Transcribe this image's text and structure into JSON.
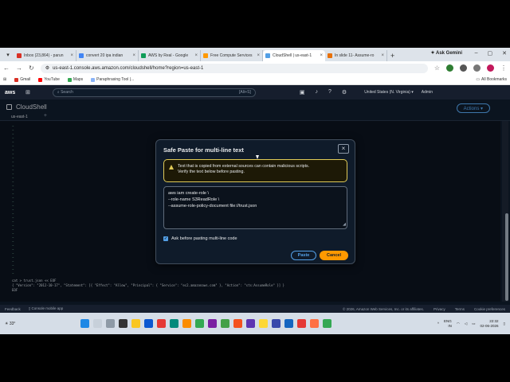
{
  "browser": {
    "tabs": [
      {
        "label": "Inbox (23,864) - parun",
        "color": "#d93025"
      },
      {
        "label": "convert 20 ipa indian",
        "color": "#4285f4"
      },
      {
        "label": "AWS by Real - Google",
        "color": "#0f9d58"
      },
      {
        "label": "Free Compute Services",
        "color": "#ff9900"
      },
      {
        "label": "CloudShell | us-east-1",
        "color": "#539fe5"
      },
      {
        "label": "In slide 11- Assume-ro",
        "color": "#e8710a"
      }
    ],
    "gemini_label": "Ask Gemini",
    "url": "us-east-1.console.aws.amazon.com/cloudshell/home?region=us-east-1",
    "bookmarks": [
      {
        "label": "Gmail",
        "color": "#d93025"
      },
      {
        "label": "YouTube",
        "color": "#ff0000"
      },
      {
        "label": "Maps",
        "color": "#34a853"
      },
      {
        "label": "Paraphrasing Tool |...",
        "color": "#8ab4f8"
      }
    ],
    "all_bookmarks": "All Bookmarks"
  },
  "aws": {
    "logo": "aws",
    "search_placeholder": "Search",
    "search_shortcut": "[Alt+S]",
    "region": "United States (N. Virginia) ▾",
    "account": "Admin"
  },
  "cloudshell": {
    "title": "CloudShell",
    "actions_label": "Actions ▾",
    "tab": "us-east-1",
    "terminal_lines": [
      "cat > trust.json << EOF",
      "{ \"Version\": \"2012-10-17\", \"Statement\": [{ \"Effect\": \"Allow\", \"Principal\": { \"Service\": \"ec2.amazonaws.com\" }, \"Action\": \"sts:AssumeRole\" }] }",
      "EOF"
    ]
  },
  "footer": {
    "feedback": "Feedback",
    "console_app": "Console mobile app",
    "copyright": "© 2026, Amazon Web Services, Inc. or its affiliates.",
    "privacy": "Privacy",
    "terms": "Terms",
    "cookie": "Cookie preferences"
  },
  "modal": {
    "title": "Safe Paste for multi-line text",
    "warning_line1": "Text that is copied from external sources can contain malicious scripts.",
    "warning_line2": "Verify the text below before pasting.",
    "code_lines": [
      "aws iam create-role \\",
      "  --role-name S3ReadRole \\",
      "  --assume-role-policy-document file://trust.json"
    ],
    "checkbox_label": "Ask before pasting multi-line code",
    "paste_label": "Paste",
    "cancel_label": "Cancel"
  },
  "taskbar": {
    "temperature": "33°",
    "lang_line1": "ENG",
    "lang_line2": "IN",
    "time": "22:32",
    "date": "02-06-2026"
  },
  "colors": {
    "accent": "#539fe5",
    "primary_button": "#ff9900",
    "warning": "#e0ca57",
    "background": "#0f1b2a"
  }
}
